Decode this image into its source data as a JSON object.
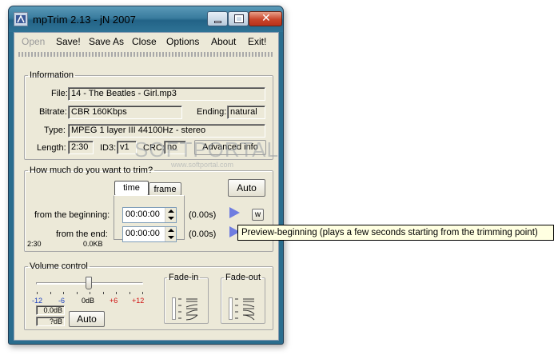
{
  "window": {
    "title": "mpTrim 2.13 - jN 2007"
  },
  "menu": [
    "Open",
    "Save!",
    "Save As",
    "Close",
    "Options",
    "About",
    "Exit!"
  ],
  "info": {
    "legend": "Information",
    "file_label": "File:",
    "file_value": "14 - The Beatles - Girl.mp3",
    "bitrate_label": "Bitrate:",
    "bitrate_value": "CBR 160Kbps",
    "ending_label": "Ending:",
    "ending_value": "natural",
    "type_label": "Type:",
    "type_value": "MPEG 1 layer III 44100Hz - stereo",
    "length_label": "Length:",
    "length_value": "2:30",
    "id3_label": "ID3:",
    "id3_value": "v1",
    "crc_label": "CRC:",
    "crc_value": "no",
    "advanced_label": "Advanced info"
  },
  "trim": {
    "legend": "How much do you want to trim?",
    "tab_time": "time",
    "tab_frame": "frame",
    "auto_label": "Auto",
    "begin_label": "from the beginning:",
    "begin_value": "00:00:00",
    "begin_secs": "(0.00s)",
    "end_label": "from the end:",
    "end_value": "00:00:00",
    "end_secs": "(0.00s)",
    "w_label": "w",
    "total_time": "2:30",
    "size": "0.0KB"
  },
  "volume": {
    "legend": "Volume control",
    "ticks": [
      "-12",
      "-6",
      "0dB",
      "+6",
      "+12"
    ],
    "level_db": "0.0dB",
    "peak_db": "?dB",
    "auto_label": "Auto",
    "fadein_legend": "Fade-in",
    "fadeout_legend": "Fade-out"
  },
  "tooltip": "Preview-beginning (plays a few seconds starting from the trimming point)",
  "watermark": {
    "main": "SOFTPORTAL",
    "sub": "www.softportal.com"
  },
  "colors": {
    "menu_disabled": "#9a9a9a",
    "tick_negative": "#1a3fbf",
    "tick_positive": "#d01010",
    "play_button": "#6f7de0"
  }
}
